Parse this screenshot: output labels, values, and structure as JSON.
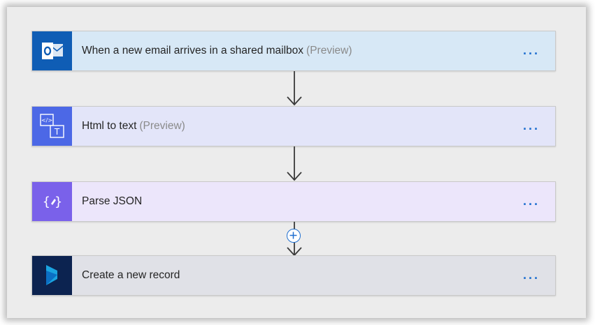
{
  "flow": {
    "steps": [
      {
        "title": "When a new email arrives in a shared mailbox",
        "tag": "(Preview)",
        "more": "...",
        "icon": "outlook-icon",
        "icon_bg": "#0f5db5",
        "card_bg": "#d7e8f6"
      },
      {
        "title": "Html to text",
        "tag": "(Preview)",
        "more": "...",
        "icon": "html-to-text-icon",
        "icon_bg": "#4c68e6",
        "card_bg": "#e3e5f9"
      },
      {
        "title": "Parse JSON",
        "tag": "",
        "more": "...",
        "icon": "parse-json-icon",
        "icon_bg": "#7a61ea",
        "card_bg": "#ece6fb"
      },
      {
        "title": "Create a new record",
        "tag": "",
        "more": "...",
        "icon": "dynamics-icon",
        "icon_bg": "#0c2350",
        "card_bg": "#e0e1e7"
      }
    ],
    "connector_color": "#3a3a3a",
    "accent": "#1f6fd0",
    "insert_step": "add-step-icon"
  }
}
